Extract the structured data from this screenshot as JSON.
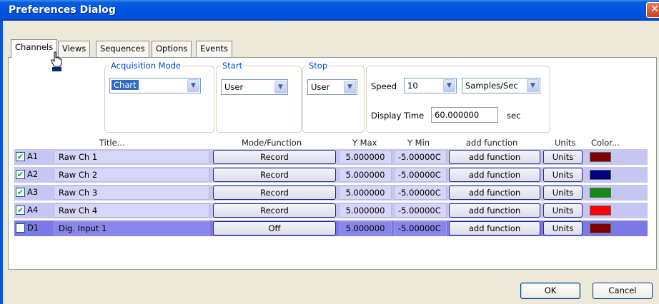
{
  "window": {
    "title": "Preferences Dialog",
    "close_glyph": "✕"
  },
  "tabs": [
    "Channels",
    "Views",
    "Sequences",
    "Options",
    "Events"
  ],
  "acquisition": {
    "legend": "Acquisition Mode",
    "mode_value": "Chart"
  },
  "start": {
    "legend": "Start",
    "value": "User"
  },
  "stop": {
    "legend": "Stop",
    "value": "User"
  },
  "speed": {
    "label": "Speed",
    "value": "10",
    "unit_value": "Samples/Sec",
    "display_time_label": "Display Time",
    "display_time_value": "60.000000",
    "display_time_unit": "sec"
  },
  "columns": {
    "title": "Title...",
    "mode": "Mode/Function",
    "ymax": "Y Max",
    "ymin": "Y Min",
    "add_function": "add function",
    "units": "Units",
    "color": "Color..."
  },
  "channels": [
    {
      "checked": true,
      "id": "A1",
      "title": "Raw Ch 1",
      "mode": "Record",
      "ymax": "5.000000",
      "ymin": "-5.00000C",
      "fn": "add function",
      "units": "Units",
      "color": "#7f0000"
    },
    {
      "checked": true,
      "id": "A2",
      "title": "Raw Ch 2",
      "mode": "Record",
      "ymax": "5.000000",
      "ymin": "-5.00000C",
      "fn": "add function",
      "units": "Units",
      "color": "#00007f"
    },
    {
      "checked": true,
      "id": "A3",
      "title": "Raw Ch 3",
      "mode": "Record",
      "ymax": "5.000000",
      "ymin": "-5.00000C",
      "fn": "add function",
      "units": "Units",
      "color": "#158b15"
    },
    {
      "checked": true,
      "id": "A4",
      "title": "Raw Ch 4",
      "mode": "Record",
      "ymax": "5.000000",
      "ymin": "-5.00000C",
      "fn": "add function",
      "units": "Units",
      "color": "#ff0000"
    },
    {
      "checked": false,
      "id": "D1",
      "title": "Dig. Input 1",
      "mode": "Off",
      "ymax": "5.000000",
      "ymin": "-5.00000C",
      "fn": "add function",
      "units": "Units",
      "color": "#7f0000"
    }
  ],
  "buttons": {
    "ok": "OK",
    "cancel": "Cancel"
  },
  "icons": {
    "check": "✔",
    "arrow": "▼"
  }
}
